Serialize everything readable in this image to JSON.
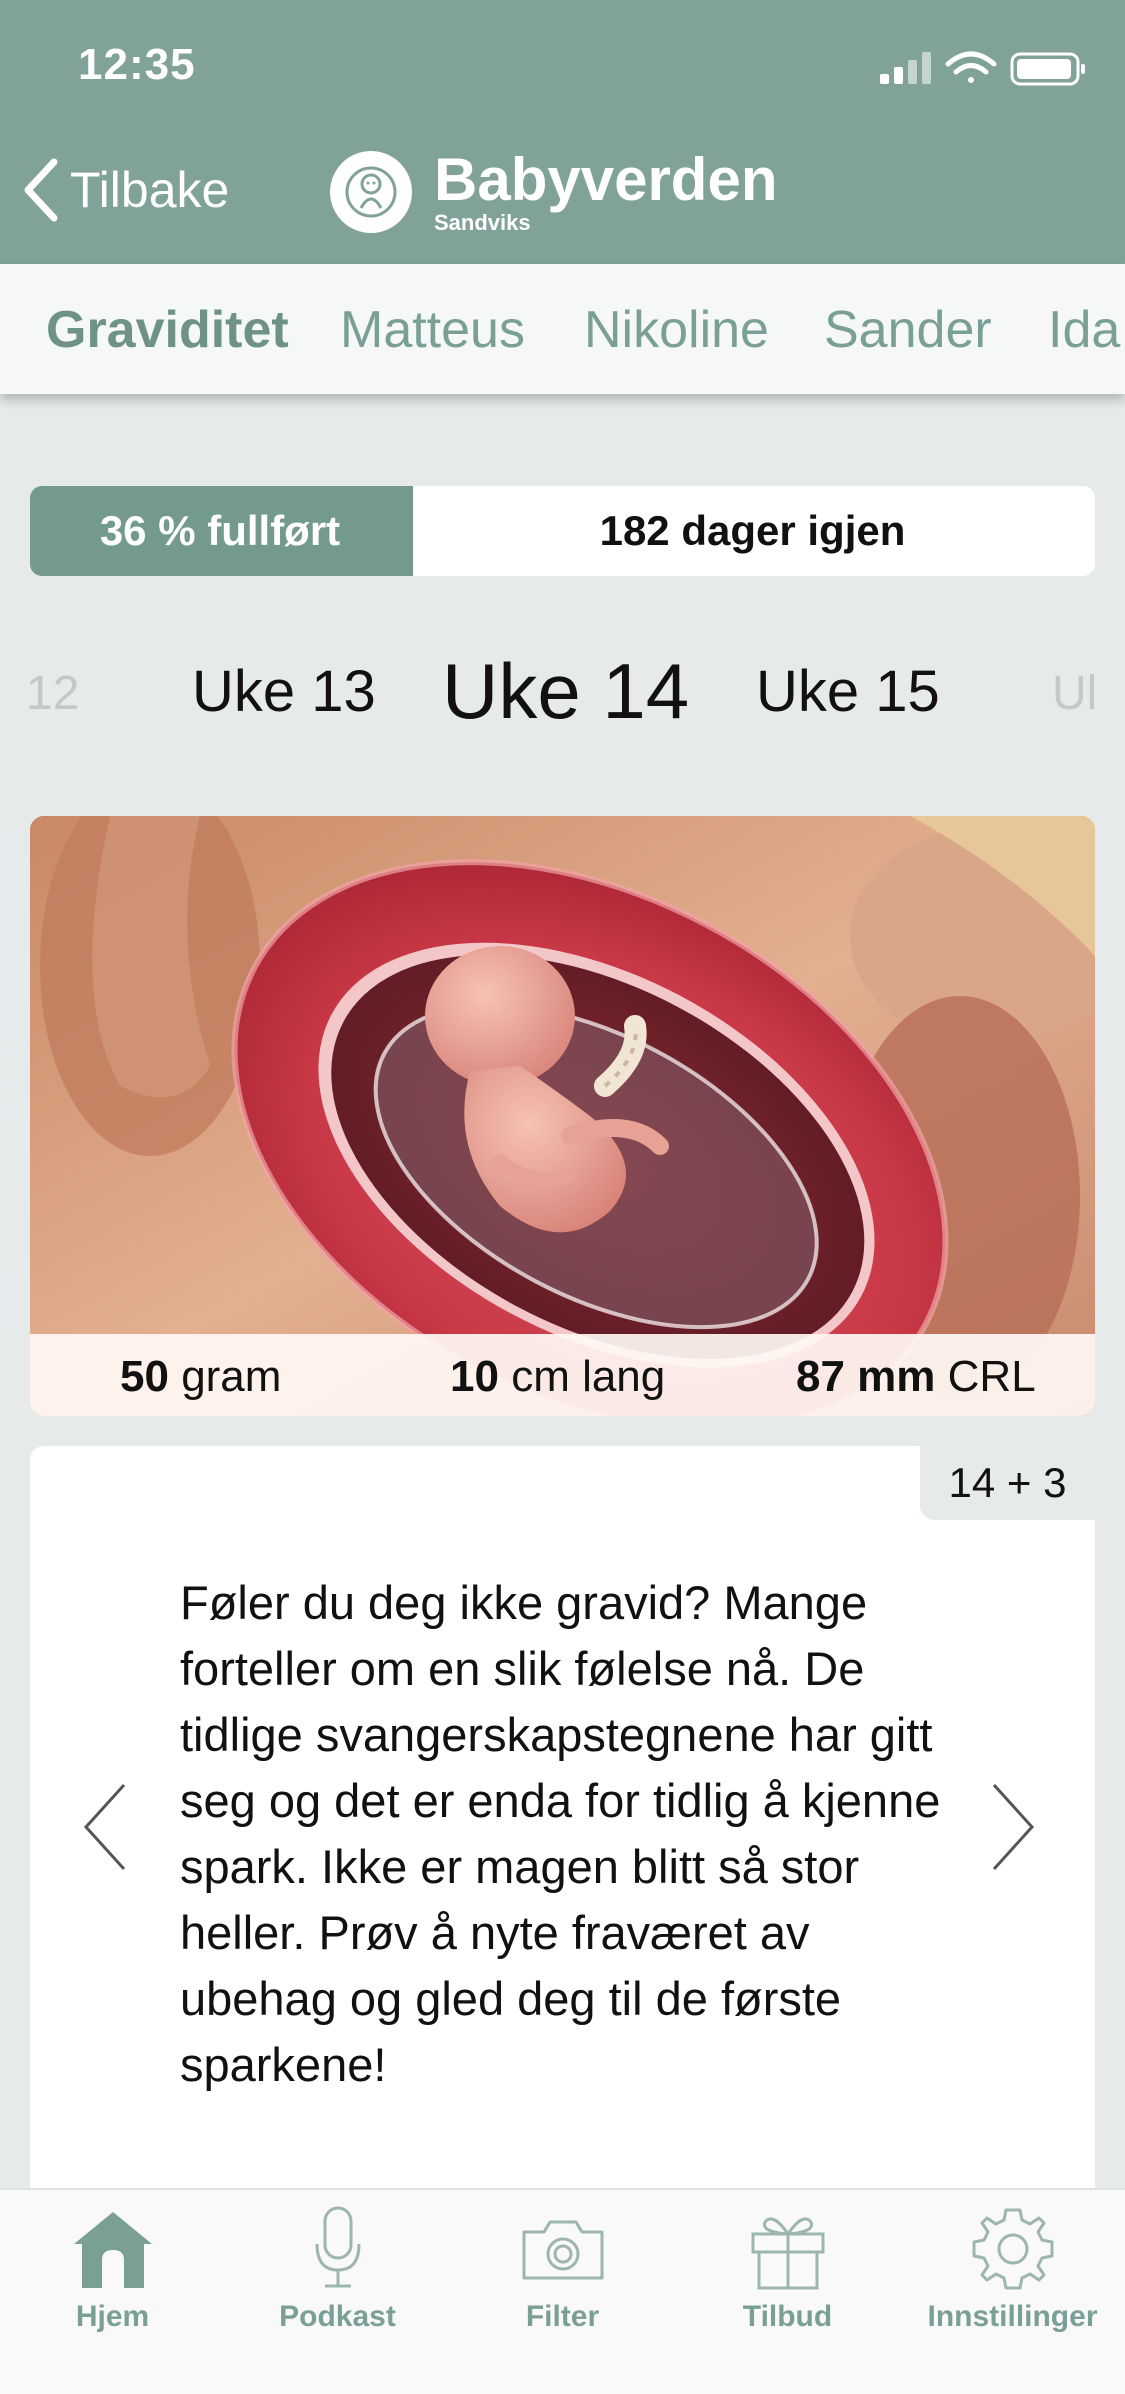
{
  "status_bar": {
    "time": "12:35"
  },
  "header": {
    "back_label": "Tilbake",
    "app_name": "Babyverden",
    "app_subtitle": "Sandviks"
  },
  "tabs": [
    {
      "label": "Graviditet",
      "active": true
    },
    {
      "label": "Matteus"
    },
    {
      "label": "Nikoline"
    },
    {
      "label": "Sander"
    },
    {
      "label": "Ida"
    }
  ],
  "progress": {
    "fraction_complete": 0.36,
    "complete_label": "36 % fullført",
    "remaining_label": "182 dager igjen"
  },
  "weeks": {
    "prev2": "12",
    "prev": "Uke 13",
    "current": "Uke 14",
    "next": "Uke 15",
    "next2": "Uk"
  },
  "baby_stats": {
    "weight_value": "50",
    "weight_unit": "gram",
    "length_value": "10",
    "length_unit": "cm lang",
    "crl_value": "87 mm",
    "crl_unit": "CRL"
  },
  "info_card": {
    "day_label": "14 + 3",
    "text": "Føler du deg ikke gravid? Mange forteller om en slik følelse nå. De tidlige svangerskapstegnene har gitt seg og det er enda for tidlig å kjenne spark. Ikke er magen blitt så stor heller. Prøv å nyte fraværet av ubehag og gled deg til de første sparkene!"
  },
  "bottom_nav": [
    {
      "label": "Hjem",
      "icon": "home-icon",
      "active": true
    },
    {
      "label": "Podkast",
      "icon": "microphone-icon"
    },
    {
      "label": "Filter",
      "icon": "camera-icon"
    },
    {
      "label": "Tilbud",
      "icon": "gift-icon"
    },
    {
      "label": "Innstillinger",
      "icon": "gear-icon"
    }
  ],
  "colors": {
    "header_bg": "#80a298",
    "accent": "#739a8d",
    "page_bg": "#e6eaea"
  }
}
